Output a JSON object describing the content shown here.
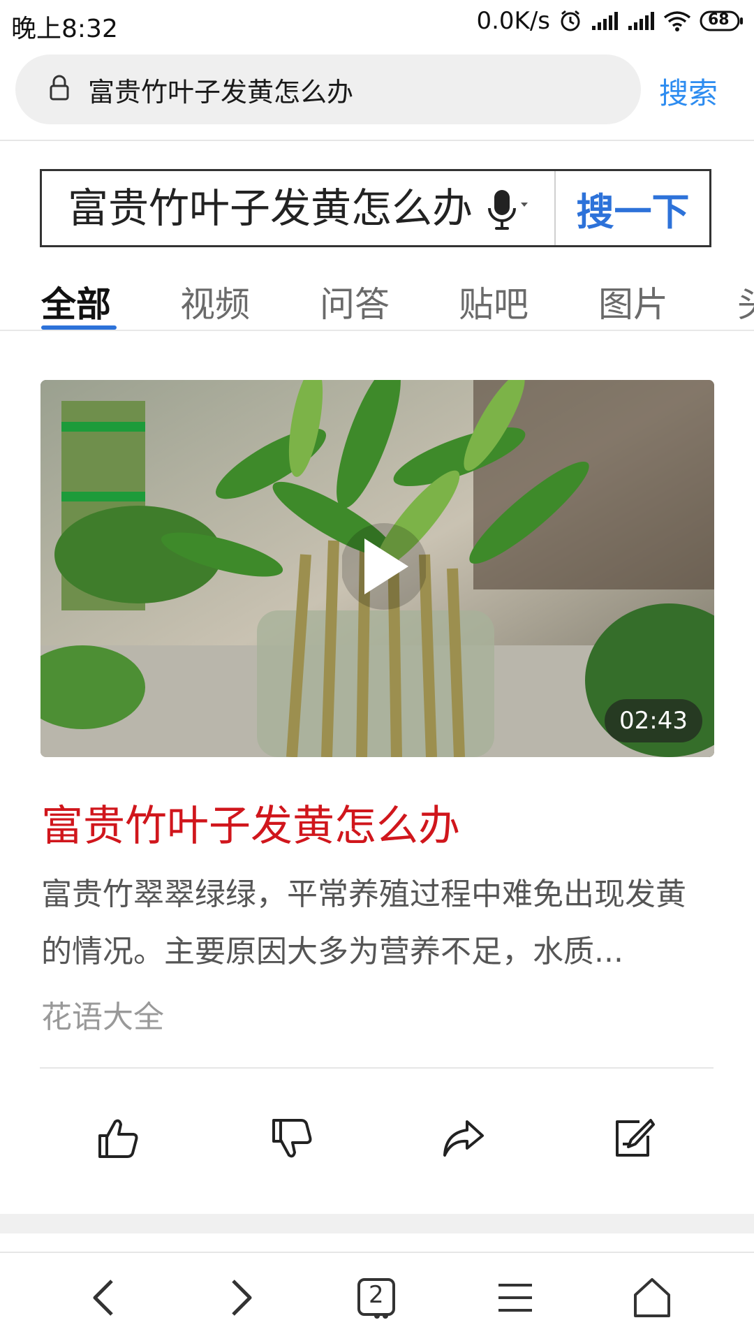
{
  "status_bar": {
    "time": "晚上8:32",
    "net_speed": "0.0K/s",
    "battery": "68"
  },
  "address_bar": {
    "query": "富贵竹叶子发黄怎么办",
    "search_label": "搜索"
  },
  "search_box": {
    "value": "富贵竹叶子发黄怎么办",
    "button_label": "搜一下"
  },
  "tabs": [
    {
      "label": "全部",
      "active": true
    },
    {
      "label": "视频",
      "active": false
    },
    {
      "label": "问答",
      "active": false
    },
    {
      "label": "贴吧",
      "active": false
    },
    {
      "label": "图片",
      "active": false
    },
    {
      "label": "头",
      "active": false
    }
  ],
  "result": {
    "duration": "02:43",
    "title": "富贵竹叶子发黄怎么办",
    "snippet": "富贵竹翠翠绿绿，平常养殖过程中难免出现发黄的情况。主要原因大多为营养不足，水质...",
    "source": "花语大全"
  },
  "actions": [
    "like-icon",
    "dislike-icon",
    "share-icon",
    "edit-icon"
  ],
  "bottom_nav": {
    "tab_count": "2"
  },
  "colors": {
    "accent_blue": "#2d72d9",
    "title_red": "#d0161c"
  }
}
